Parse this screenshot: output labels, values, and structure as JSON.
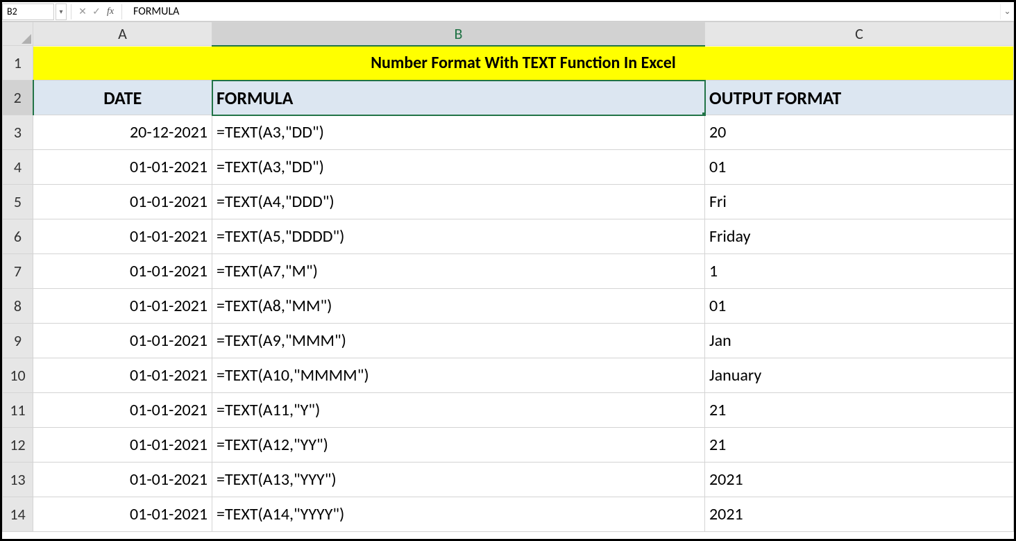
{
  "nameBox": "B2",
  "formulaBar": "FORMULA",
  "columns": [
    "A",
    "B",
    "C"
  ],
  "rowNumbers": [
    "1",
    "2",
    "3",
    "4",
    "5",
    "6",
    "7",
    "8",
    "9",
    "10",
    "11",
    "12",
    "13",
    "14"
  ],
  "selected": {
    "cell": "B2",
    "col": "B",
    "row": "2"
  },
  "title": "Number Format With TEXT Function In Excel",
  "headers": {
    "A": "DATE",
    "B": "FORMULA",
    "C": "OUTPUT FORMAT"
  },
  "rows": [
    {
      "A": "20-12-2021",
      "B": "=TEXT(A3,\"DD\")",
      "C": "20"
    },
    {
      "A": "01-01-2021",
      "B": "=TEXT(A3,\"DD\")",
      "C": "01"
    },
    {
      "A": "01-01-2021",
      "B": "=TEXT(A4,\"DDD\")",
      "C": "Fri"
    },
    {
      "A": "01-01-2021",
      "B": "=TEXT(A5,\"DDDD\")",
      "C": "Friday"
    },
    {
      "A": "01-01-2021",
      "B": "=TEXT(A7,\"M\")",
      "C": "1"
    },
    {
      "A": "01-01-2021",
      "B": "=TEXT(A8,\"MM\")",
      "C": "01"
    },
    {
      "A": "01-01-2021",
      "B": "=TEXT(A9,\"MMM\")",
      "C": "Jan"
    },
    {
      "A": "01-01-2021",
      "B": "=TEXT(A10,\"MMMM\")",
      "C": "January"
    },
    {
      "A": "01-01-2021",
      "B": "=TEXT(A11,\"Y\")",
      "C": "21"
    },
    {
      "A": "01-01-2021",
      "B": "=TEXT(A12,\"YY\")",
      "C": "21"
    },
    {
      "A": "01-01-2021",
      "B": "=TEXT(A13,\"YYY\")",
      "C": "2021"
    },
    {
      "A": "01-01-2021",
      "B": "=TEXT(A14,\"YYYY\")",
      "C": "2021"
    }
  ]
}
